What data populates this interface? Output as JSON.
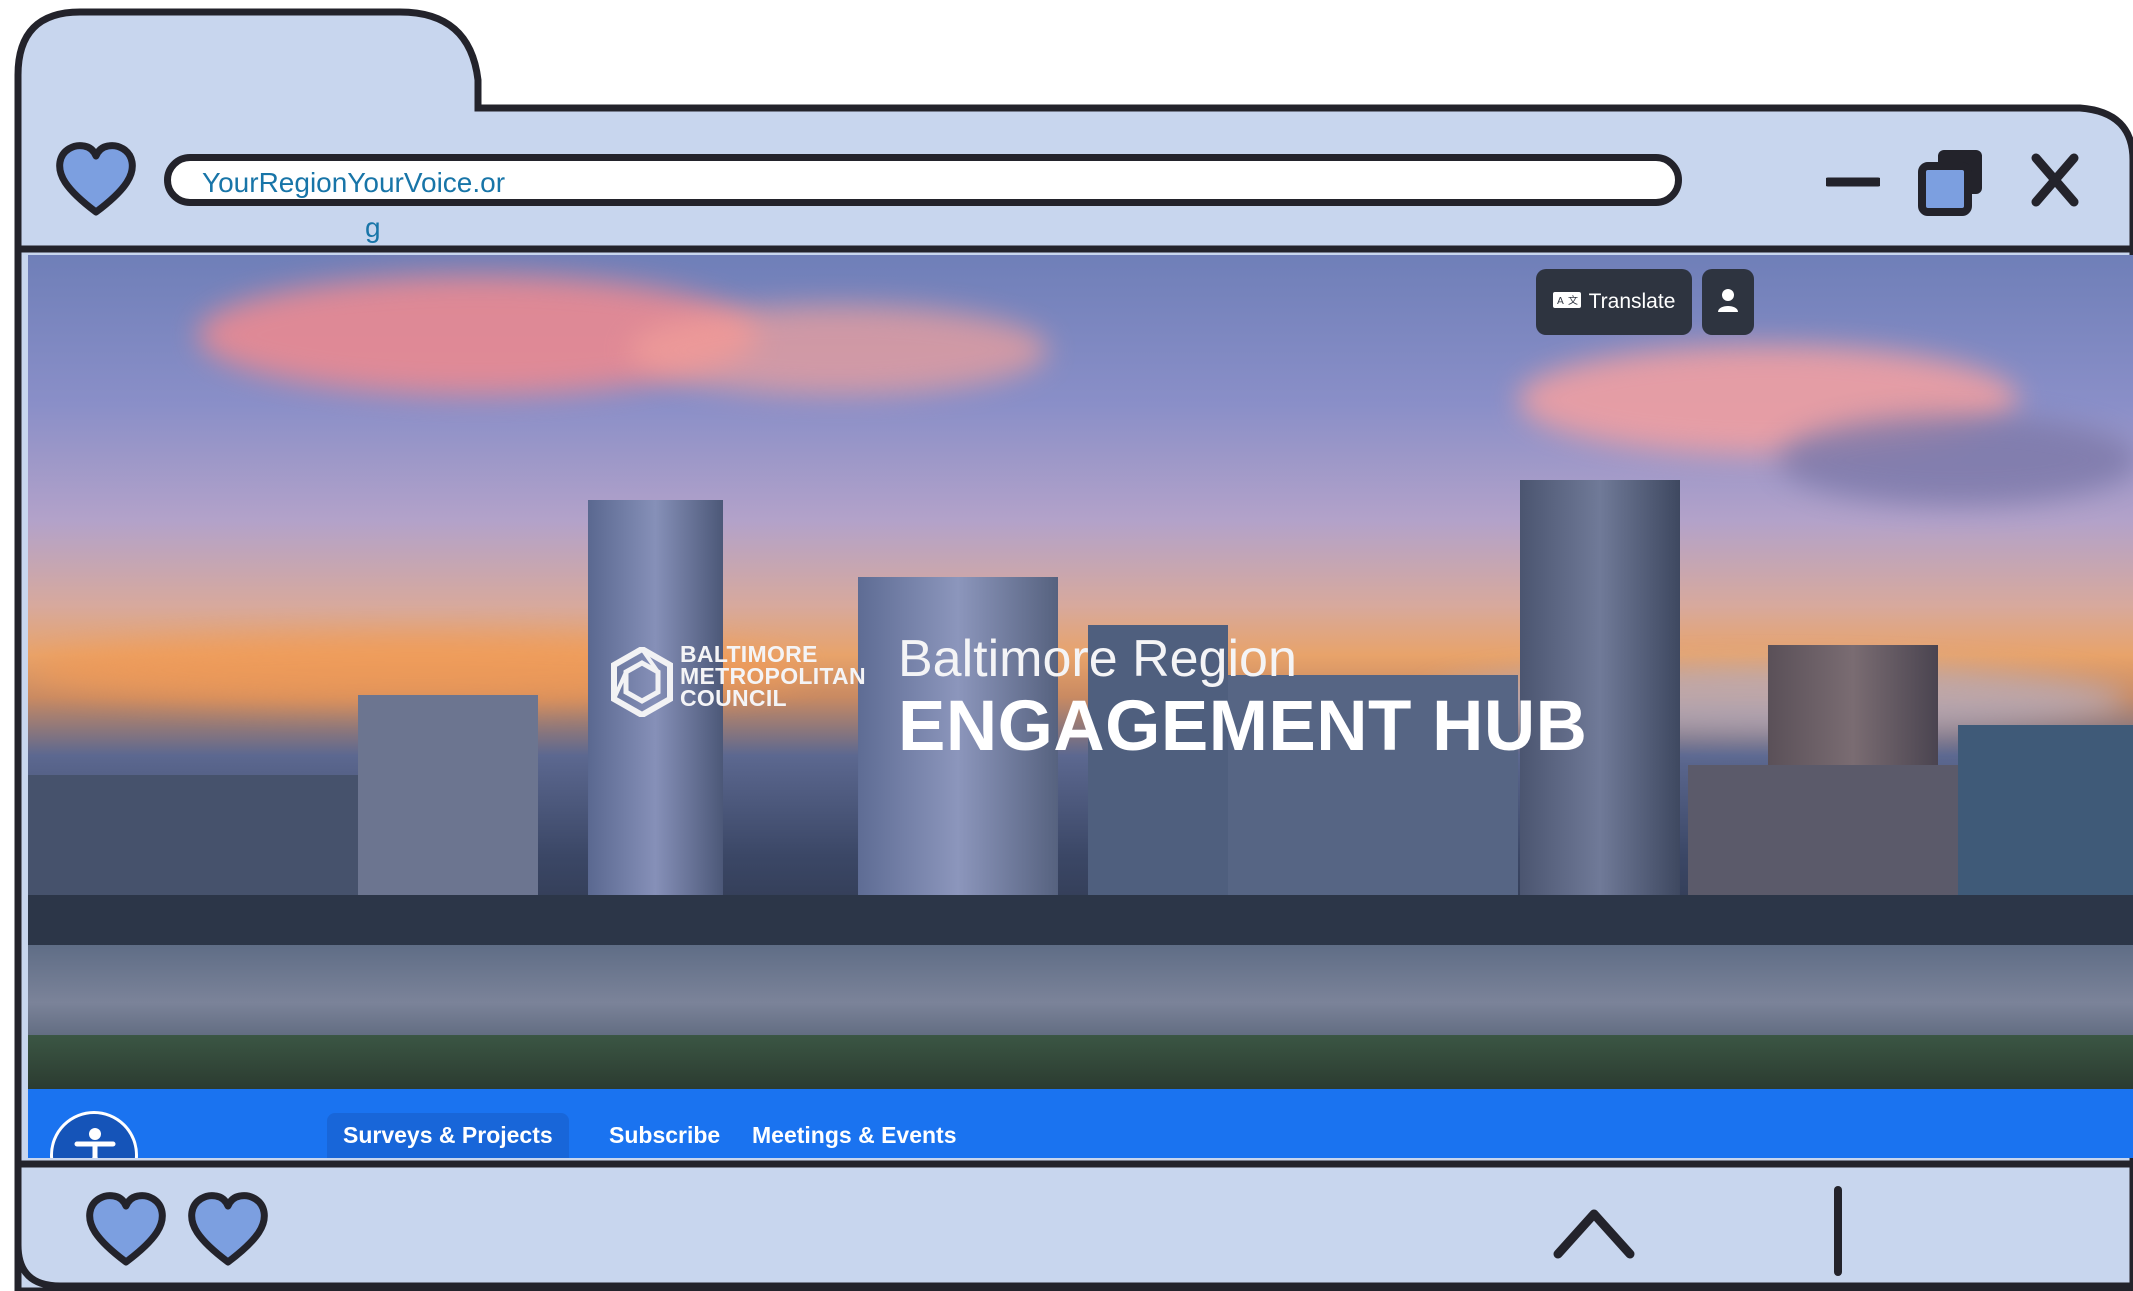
{
  "browser": {
    "url": "YourRegionYourVoice.or",
    "url_wrap": "g",
    "favorite_icon": "heart-icon",
    "bottom_icons": [
      "heart-icon",
      "heart-icon",
      "chevron-up-icon",
      "divider-line"
    ],
    "window_controls": [
      "minimize-icon",
      "restore-icon",
      "close-icon"
    ],
    "frame_color": "#c8d6ee",
    "outline_color": "#23232b"
  },
  "header": {
    "translate_label": "Translate",
    "translate_icon": "translate-icon",
    "account_icon": "user-icon"
  },
  "hero": {
    "org_lines": [
      "BALTIMORE",
      "METROPOLITAN",
      "COUNCIL"
    ],
    "subtitle": "Baltimore Region",
    "title": "ENGAGEMENT HUB"
  },
  "nav": {
    "accessibility_icon": "accessibility-icon",
    "items": [
      {
        "label": "Surveys & Projects",
        "active": true
      },
      {
        "label": "Subscribe",
        "active": false
      },
      {
        "label": "Meetings & Events",
        "active": false
      }
    ],
    "accent": "#1a73f0"
  }
}
